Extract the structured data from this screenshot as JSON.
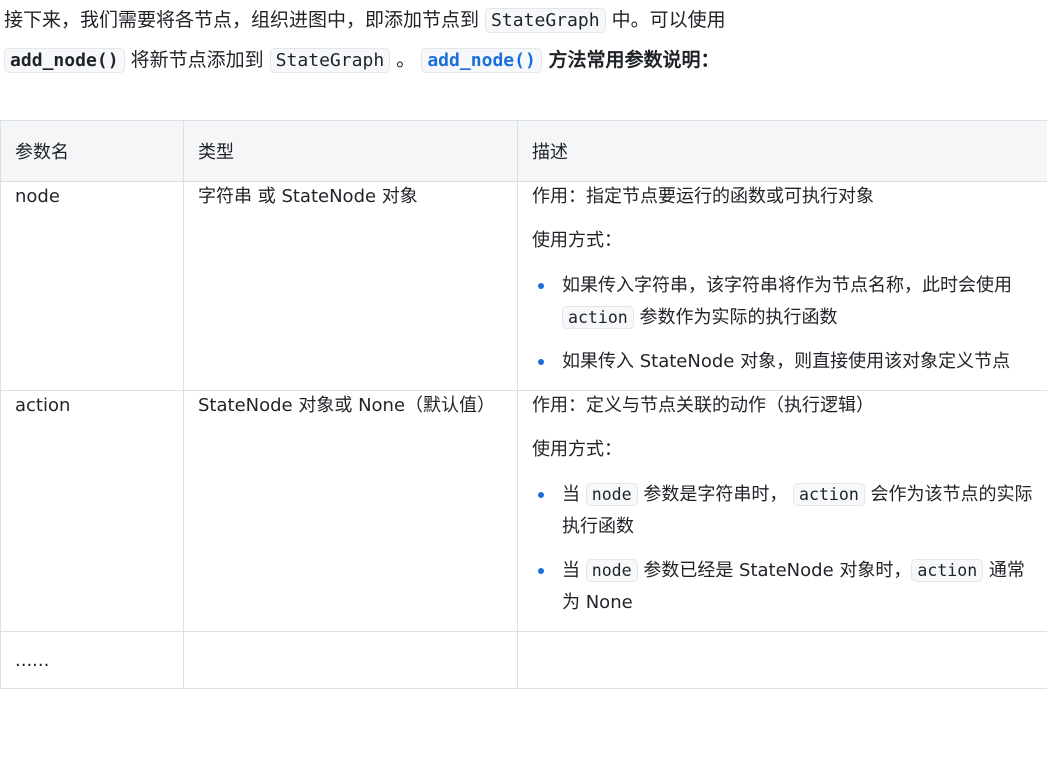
{
  "intro": {
    "line1_a": "接下来，我们需要将各节点，组织进图中，即添加节点到 ",
    "line1_code": "StateGraph",
    "line1_b": " 中。可以使用",
    "line2_code1": "add_node()",
    "line2_a": " 将新节点添加到 ",
    "line2_code2": "StateGraph",
    "line2_b": " 。 ",
    "line2_link": "add_node()",
    "line2_bold": " 方法常用参数说明："
  },
  "table": {
    "headers": [
      "参数名",
      "类型",
      "描述"
    ],
    "rows": [
      {
        "name": "node",
        "type": "字符串 或 StateNode 对象",
        "desc_title": "作用：指定节点要运行的函数或可执行对象",
        "desc_usage": "使用方式：",
        "bullet1_a": "如果传入字符串，该字符串将作为节点名称，此时会使用 ",
        "bullet1_code": "action",
        "bullet1_b": " 参数作为实际的执行函数",
        "bullet2": "如果传入 StateNode 对象，则直接使用该对象定义节点"
      },
      {
        "name": "action",
        "type": "StateNode 对象或 None（默认值）",
        "desc_title": "作用：定义与节点关联的动作（执行逻辑）",
        "desc_usage": "使用方式：",
        "bullet1_a": "当 ",
        "bullet1_code1": "node",
        "bullet1_b": " 参数是字符串时， ",
        "bullet1_code2": "action",
        "bullet1_c": " 会作为该节点的实际执行函数",
        "bullet2_a": "当 ",
        "bullet2_code1": "node",
        "bullet2_b": " 参数已经是 StateNode 对象时，",
        "bullet2_code2": "action",
        "bullet2_c": " 通常为 None"
      },
      {
        "name": "......",
        "type": "",
        "desc": ""
      }
    ]
  },
  "colors": {
    "accent": "#1a6fd8",
    "header_bg": "#f5f6f8",
    "border": "#dcdfe4"
  }
}
